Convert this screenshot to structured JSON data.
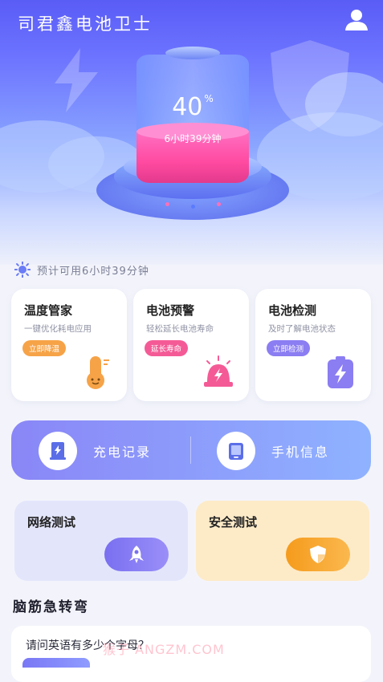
{
  "app": {
    "title": "司君鑫电池卫士"
  },
  "battery": {
    "percent": "40",
    "percent_unit": "%",
    "percent_value": 40,
    "time_remaining": "6小时39分钟"
  },
  "estimate": {
    "text": "预计可用6小时39分钟"
  },
  "feature_cards": [
    {
      "title": "温度管家",
      "desc": "一键优化耗电应用",
      "button": "立即降温",
      "button_color": "#f6a348",
      "icon": "thermometer-icon"
    },
    {
      "title": "电池预警",
      "desc": "轻松延长电池寿命",
      "button": "延长寿命",
      "button_color": "#f45b96",
      "icon": "alarm-icon"
    },
    {
      "title": "电池检测",
      "desc": "及时了解电池状态",
      "button": "立即检测",
      "button_color": "#8b7df2",
      "icon": "battery-bolt-icon"
    }
  ],
  "quick_actions": [
    {
      "label": "充电记录",
      "icon": "charge-record-icon"
    },
    {
      "label": "手机信息",
      "icon": "phone-info-icon"
    }
  ],
  "tests": [
    {
      "title": "网络测试",
      "icon": "rocket-icon",
      "bg": "#e3e6fb",
      "pill": "#7a6ff0"
    },
    {
      "title": "安全测试",
      "icon": "shield-icon",
      "bg": "#fdebc8",
      "pill": "#f7a52a"
    }
  ],
  "brain_teaser": {
    "section_title": "脑筋急转弯",
    "question": "请问英语有多少个字母？"
  },
  "watermark": "猴子 ANGZM.COM",
  "colors": {
    "hero_top": "#5a5cf6",
    "accent": "#7a78f5",
    "battery_fill": "#ff4aa0"
  }
}
